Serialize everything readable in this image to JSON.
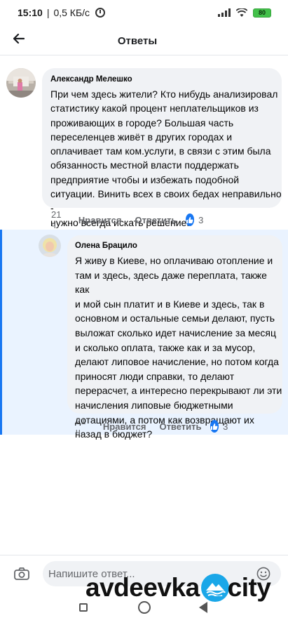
{
  "status_bar": {
    "time": "15:10",
    "separator": "|",
    "speed": "0,5 КБ/с",
    "battery": "80"
  },
  "header": {
    "title": "Ответы",
    "back_icon": "arrow-left-icon"
  },
  "comments": [
    {
      "author": "Александр Мелешко",
      "text": "При чем здесь жители? Кто нибудь анализировал\nстатистику какой процент неплательщиков из\nпроживающих в городе? Большая часть\nпереселенцев живёт в других городах и\nоплачивает там ком.услуги, в связи с этим была\nобязанность местной власти поддержать\nпредприятие чтобы и избежать подобной\nситуации. Винить всех в своих бедах неправильно -\nнужно всегда искать решение.",
      "time": "21 ч.",
      "like_label": "Нравится",
      "reply_label": "Ответить",
      "likes": "3"
    },
    {
      "author": "Олена Брацило",
      "text": "Я живу в Киеве, но оплачиваю отопление и\nтам и здесь, здесь даже переплата, также как\nи мой сын платит и в Киеве и здесь, так в\nосновном и остальные семьи делают, пусть\nвыложат сколько идет начисление за месяц\nи сколько оплата, также как и за мусор,\nделают липовое начисление, но потом когда\nприносят люди справки, то делают\nперерасчет, а интересно перекрывают ли эти\nначисления липовые бюджетными\nдотациями, а потом как возвращают их\nназад в бюджет?",
      "time": "21 ч.",
      "like_label": "Нравится",
      "reply_label": "Ответить",
      "likes": "3"
    }
  ],
  "composer": {
    "placeholder": "Напишите ответ..."
  },
  "watermark": {
    "left": "avdeevka",
    "right": "city"
  },
  "colors": {
    "accent": "#1877f2",
    "bubble": "#f0f2f5",
    "highlight": "#eaf3ff"
  }
}
